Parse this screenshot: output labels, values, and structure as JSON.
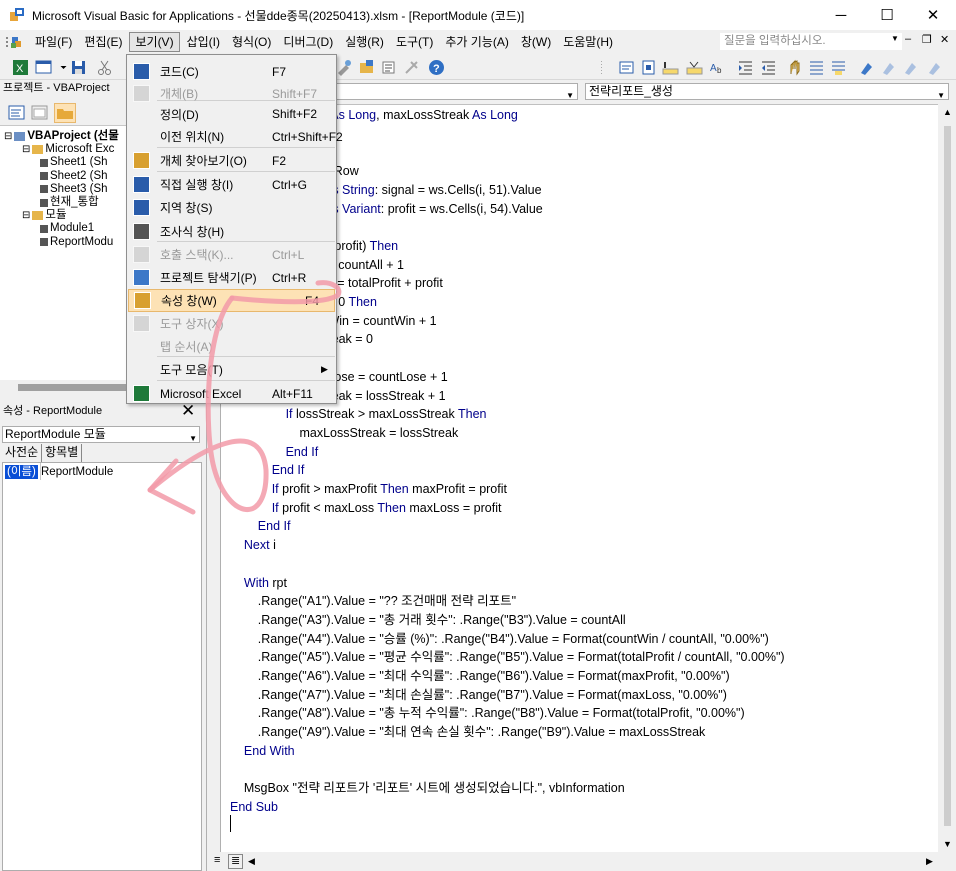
{
  "window": {
    "title": "Microsoft Visual Basic for Applications - 선물dde종목(20250413).xlsm - [ReportModule (코드)]",
    "minimize": "─",
    "maximize": "☐",
    "close": "✕"
  },
  "menubar": {
    "items": [
      {
        "label": "파일(F)",
        "name": "menu-file"
      },
      {
        "label": "편집(E)",
        "name": "menu-edit"
      },
      {
        "label": "보기(V)",
        "name": "menu-view"
      },
      {
        "label": "삽입(I)",
        "name": "menu-insert"
      },
      {
        "label": "형식(O)",
        "name": "menu-format"
      },
      {
        "label": "디버그(D)",
        "name": "menu-debug"
      },
      {
        "label": "실행(R)",
        "name": "menu-run"
      },
      {
        "label": "도구(T)",
        "name": "menu-tools"
      },
      {
        "label": "추가 기능(A)",
        "name": "menu-addins"
      },
      {
        "label": "창(W)",
        "name": "menu-window"
      },
      {
        "label": "도움말(H)",
        "name": "menu-help"
      }
    ],
    "help_placeholder": "질문을 입력하십시오.",
    "mdi_minimize": "–",
    "mdi_restore": "❐",
    "mdi_close": "✕"
  },
  "project": {
    "title": "프로젝트 - VBAProject",
    "tree": [
      {
        "text": "VBAProject (선물",
        "indent": 0,
        "bold": true,
        "toggle": "⊟"
      },
      {
        "text": "Microsoft Exc",
        "indent": 1,
        "toggle": "⊟"
      },
      {
        "text": "Sheet1 (Sh",
        "indent": 2
      },
      {
        "text": "Sheet2 (Sh",
        "indent": 2
      },
      {
        "text": "Sheet3 (Sh",
        "indent": 2
      },
      {
        "text": "현재_통합",
        "indent": 2
      },
      {
        "text": "모듈",
        "indent": 1,
        "toggle": "⊟"
      },
      {
        "text": "Module1",
        "indent": 2
      },
      {
        "text": "ReportModu",
        "indent": 2
      }
    ]
  },
  "properties": {
    "title": "속성 - ReportModule",
    "close": "✕",
    "combo": "ReportModule 모듈",
    "tab_alpha": "사전순",
    "tab_category": "항목별",
    "row_name": "(이름)",
    "row_value": "ReportModule"
  },
  "code": {
    "object_combo": "",
    "proc_combo": "전략리포트_생성",
    "lines": [
      ": As Long, maxLossStreak As Long",
      "",
      "",
      "stRow",
      "As String: signal = ws.Cells(i, 51).Value",
      "As Variant: profit = ws.Cells(i, 54).Value",
      "",
      "c(profit) Then",
      " = countAll + 1",
      "fit = totalProfit + profit",
      " > 0 Then",
      "tWin = countWin + 1",
      "treak = 0",
      "",
      "tLose = countLose + 1",
      "treak = lossStreak + 1",
      "                If lossStreak > maxLossStreak Then",
      "                    maxLossStreak = lossStreak",
      "                End If",
      "            End If",
      "            If profit > maxProfit Then maxProfit = profit",
      "            If profit < maxLoss Then maxLoss = profit",
      "        End If",
      "    Next i",
      "",
      "    With rpt",
      "        .Range(\"A1\").Value = \"?? 조건매매 전략 리포트\"",
      "        .Range(\"A3\").Value = \"총 거래 횟수\": .Range(\"B3\").Value = countAll",
      "        .Range(\"A4\").Value = \"승률 (%)\": .Range(\"B4\").Value = Format(countWin / countAll, \"0.00%\")",
      "        .Range(\"A5\").Value = \"평균 수익률\": .Range(\"B5\").Value = Format(totalProfit / countAll, \"0.00%\")",
      "        .Range(\"A6\").Value = \"최대 수익률\": .Range(\"B6\").Value = Format(maxProfit, \"0.00%\")",
      "        .Range(\"A7\").Value = \"최대 손실률\": .Range(\"B7\").Value = Format(maxLoss, \"0.00%\")",
      "        .Range(\"A8\").Value = \"총 누적 수익률\": .Range(\"B8\").Value = Format(totalProfit, \"0.00%\")",
      "        .Range(\"A9\").Value = \"최대 연속 손실 횟수\": .Range(\"B9\").Value = maxLossStreak",
      "    End With",
      "",
      "    MsgBox \"전략 리포트가 '리포트' 시트에 생성되었습니다.\", vbInformation",
      "End Sub"
    ]
  },
  "view_menu": {
    "items": [
      {
        "label": "코드(C)",
        "key": "F7",
        "icon": "code-icon",
        "disabled": false
      },
      {
        "label": "개체(B)",
        "key": "Shift+F7",
        "icon": "object-icon",
        "disabled": true
      },
      {
        "label": "정의(D)",
        "key": "Shift+F2",
        "icon": "",
        "disabled": false
      },
      {
        "label": "이전 위치(N)",
        "key": "Ctrl+Shift+F2",
        "icon": "",
        "disabled": false
      },
      {
        "label": "개체 찾아보기(O)",
        "key": "F2",
        "icon": "object-browser-icon",
        "disabled": false
      },
      {
        "label": "직접 실행 창(I)",
        "key": "Ctrl+G",
        "icon": "immediate-window-icon",
        "disabled": false
      },
      {
        "label": "지역 창(S)",
        "key": "",
        "icon": "locals-window-icon",
        "disabled": false
      },
      {
        "label": "조사식 창(H)",
        "key": "",
        "icon": "watch-window-icon",
        "disabled": false
      },
      {
        "label": "호출 스택(K)...",
        "key": "Ctrl+L",
        "icon": "call-stack-icon",
        "disabled": true
      },
      {
        "label": "프로젝트 탐색기(P)",
        "key": "Ctrl+R",
        "icon": "project-explorer-icon",
        "disabled": false
      },
      {
        "label": "속성 창(W)",
        "key": "F4",
        "icon": "properties-window-icon",
        "disabled": false,
        "highlighted": true
      },
      {
        "label": "도구 상자(X)",
        "key": "",
        "icon": "toolbox-icon",
        "disabled": true
      },
      {
        "label": "탭 순서(A)",
        "key": "",
        "icon": "",
        "disabled": true
      },
      {
        "label": "도구 모음(T)",
        "key": "",
        "icon": "",
        "disabled": false,
        "submenu": true
      },
      {
        "label": "Microsoft Excel",
        "key": "Alt+F11",
        "icon": "excel-icon",
        "disabled": false
      }
    ]
  },
  "colors": {
    "keyword": "#00008b",
    "highlight": "#fde2b5",
    "selection": "#0a4fd6",
    "annotation": "#f29aa8"
  }
}
